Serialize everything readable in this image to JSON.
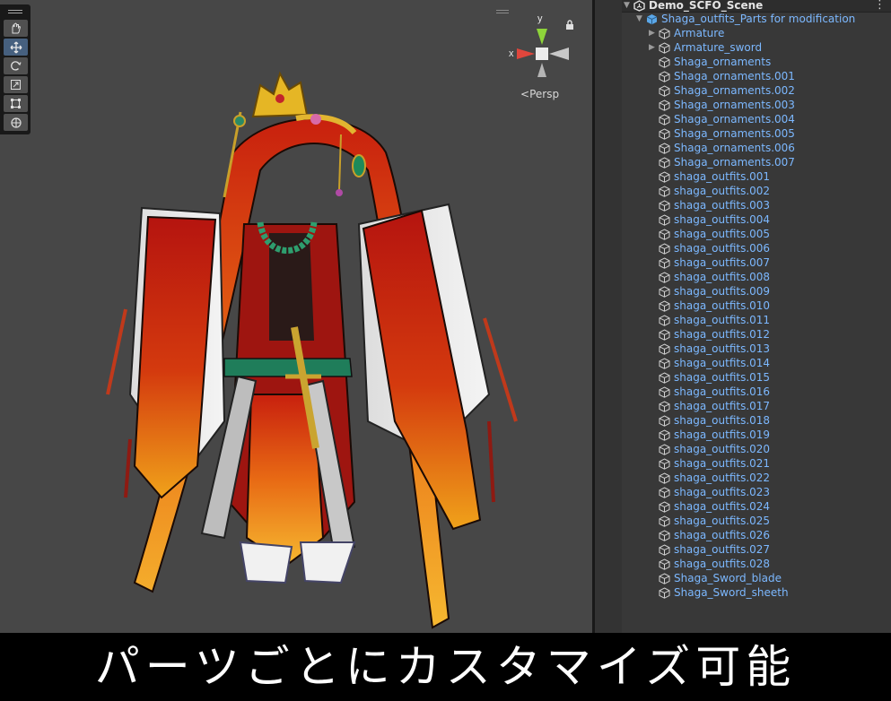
{
  "hierarchy": {
    "scene_name": "Demo_SCFO_Scene",
    "root": {
      "label": "Shaga_outfits_Parts for modification",
      "icon": "prefab-cube-icon"
    },
    "children": [
      {
        "label": "Armature",
        "expandable": true
      },
      {
        "label": "Armature_sword",
        "expandable": true
      },
      {
        "label": "Shaga_ornaments"
      },
      {
        "label": "Shaga_ornaments.001"
      },
      {
        "label": "Shaga_ornaments.002"
      },
      {
        "label": "Shaga_ornaments.003"
      },
      {
        "label": "Shaga_ornaments.004"
      },
      {
        "label": "Shaga_ornaments.005"
      },
      {
        "label": "Shaga_ornaments.006"
      },
      {
        "label": "Shaga_ornaments.007"
      },
      {
        "label": "shaga_outfits.001"
      },
      {
        "label": "shaga_outfits.002"
      },
      {
        "label": "shaga_outfits.003"
      },
      {
        "label": "shaga_outfits.004"
      },
      {
        "label": "shaga_outfits.005"
      },
      {
        "label": "shaga_outfits.006"
      },
      {
        "label": "shaga_outfits.007"
      },
      {
        "label": "shaga_outfits.008"
      },
      {
        "label": "shaga_outfits.009"
      },
      {
        "label": "shaga_outfits.010"
      },
      {
        "label": "shaga_outfits.011"
      },
      {
        "label": "shaga_outfits.012"
      },
      {
        "label": "shaga_outfits.013"
      },
      {
        "label": "shaga_outfits.014"
      },
      {
        "label": "shaga_outfits.015"
      },
      {
        "label": "shaga_outfits.016"
      },
      {
        "label": "shaga_outfits.017"
      },
      {
        "label": "shaga_outfits.018"
      },
      {
        "label": "shaga_outfits.019"
      },
      {
        "label": "shaga_outfits.020"
      },
      {
        "label": "shaga_outfits.021"
      },
      {
        "label": "shaga_outfits.022"
      },
      {
        "label": "shaga_outfits.023"
      },
      {
        "label": "shaga_outfits.024"
      },
      {
        "label": "shaga_outfits.025"
      },
      {
        "label": "shaga_outfits.026"
      },
      {
        "label": "shaga_outfits.027"
      },
      {
        "label": "shaga_outfits.028"
      },
      {
        "label": "Shaga_Sword_blade"
      },
      {
        "label": "Shaga_Sword_sheeth"
      }
    ],
    "text_color": "#7cb8ff"
  },
  "scene_view": {
    "tools": [
      "hand-tool-icon",
      "move-tool-icon",
      "rotate-tool-icon",
      "scale-tool-icon",
      "rect-tool-icon",
      "transform-tool-icon"
    ],
    "active_tool": "move-tool-icon",
    "gizmo": {
      "x_label": "x",
      "y_label": "y"
    },
    "projection_label": "Persp"
  },
  "caption": "パーツごとにカスタマイズ可能"
}
